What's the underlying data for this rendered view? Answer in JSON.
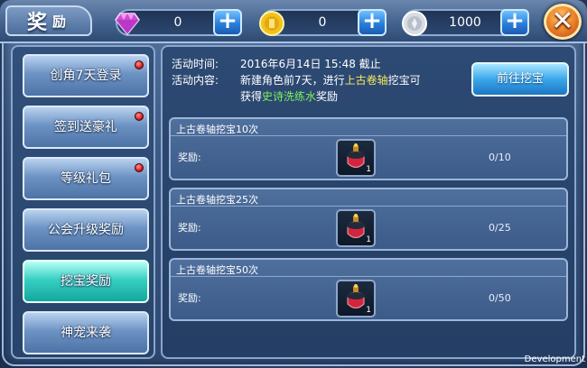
{
  "window": {
    "title_main": "奖",
    "title_sub": "励"
  },
  "currencies": [
    {
      "icon": "diamond-icon",
      "value": "0",
      "color": "#d24bd6"
    },
    {
      "icon": "gold-coin-icon",
      "value": "0",
      "color": "#f2c21c"
    },
    {
      "icon": "silver-coin-icon",
      "value": "1000",
      "color": "#d9dde3"
    }
  ],
  "plus_label": "+",
  "close_label": "✕",
  "sidebar": {
    "items": [
      {
        "label": "创角7天登录",
        "badge": true
      },
      {
        "label": "签到送豪礼",
        "badge": true
      },
      {
        "label": "等级礼包",
        "badge": true
      },
      {
        "label": "公会升级奖励",
        "badge": false
      },
      {
        "label": "挖宝奖励",
        "badge": false,
        "active": true
      },
      {
        "label": "神宠来袭",
        "badge": false
      }
    ]
  },
  "activity": {
    "time_label": "活动时间:",
    "time_value": "2016年6月14日  15:48  截止",
    "content_label": "活动内容:",
    "content_part1": "新建角色前7天，进行",
    "content_highlight1": "上古卷轴",
    "content_part2": "挖宝可",
    "content_part3": "获得",
    "content_highlight2": "史诗洗练水",
    "content_part4": "奖励",
    "go_button": "前往挖宝"
  },
  "tasks": [
    {
      "title": "上古卷轴挖宝10次",
      "reward_label": "奖励:",
      "item_qty": "1",
      "progress": "0/10"
    },
    {
      "title": "上古卷轴挖宝25次",
      "reward_label": "奖励:",
      "item_qty": "1",
      "progress": "0/25"
    },
    {
      "title": "上古卷轴挖宝50次",
      "reward_label": "奖励:",
      "item_qty": "1",
      "progress": "0/50"
    }
  ],
  "dev_label": "Development"
}
